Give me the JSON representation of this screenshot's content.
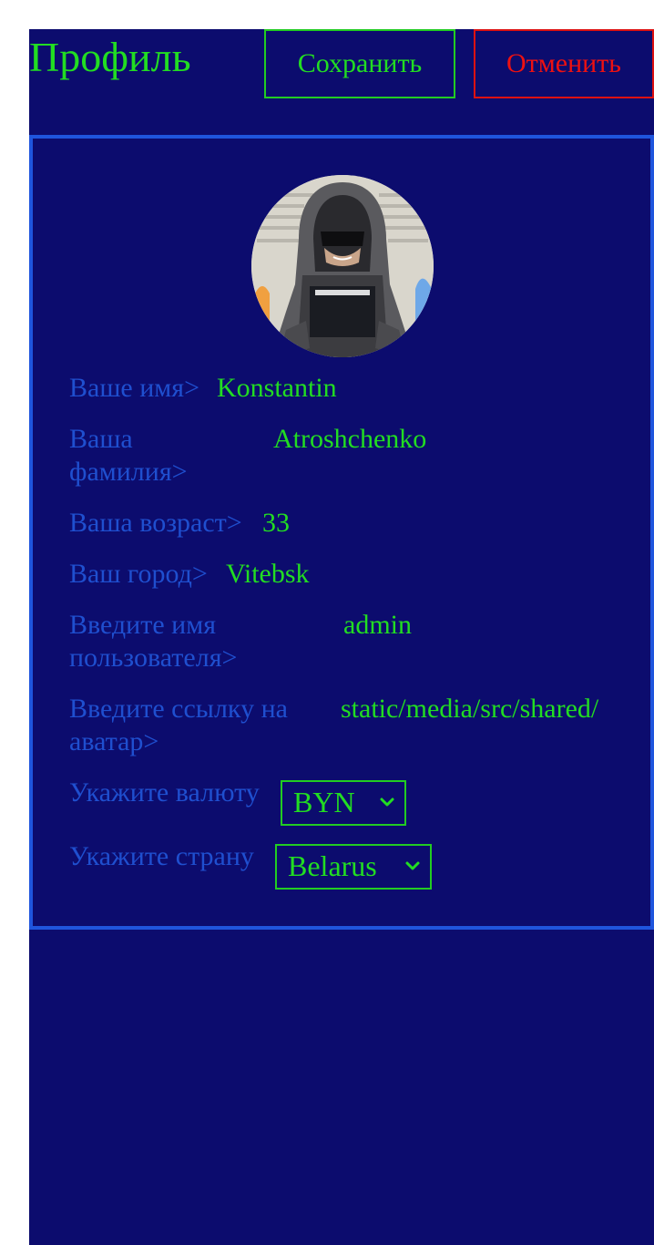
{
  "header": {
    "title": "Профиль",
    "save_label": "Сохранить",
    "cancel_label": "Отменить"
  },
  "profile": {
    "first_name_label": "Ваше имя>",
    "first_name_value": "Konstantin",
    "last_name_label_line1": "Ваша",
    "last_name_label_line2": "фамилия>",
    "last_name_value": "Atroshchenko",
    "age_label": "Ваша возраст>",
    "age_value": "33",
    "city_label": "Ваш город>",
    "city_value": "Vitebsk",
    "username_label_line1": "Введите имя",
    "username_label_line2": "пользователя>",
    "username_value": "admin",
    "avatar_label_line1": "Введите ссылку на",
    "avatar_label_line2": "аватар>",
    "avatar_value": "static/media/src/shared/",
    "currency_label": "Укажите валюту",
    "currency_value": "BYN",
    "country_label": "Укажите страну",
    "country_value": "Belarus"
  },
  "colors": {
    "background": "#0c0c6e",
    "accent_green": "#22dd22",
    "label_blue": "#1f4fcf",
    "cancel_red": "#ee1111",
    "card_border": "#1f55dd"
  },
  "icons": {
    "avatar": "hooded-hacker-avatar",
    "select_arrow": "chevron-down-icon"
  }
}
